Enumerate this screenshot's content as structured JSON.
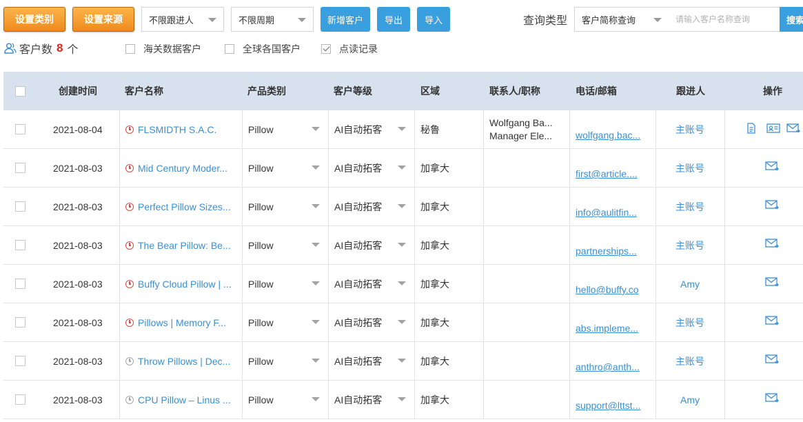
{
  "toolbar": {
    "set_category": "设置类别",
    "set_source": "设置来源",
    "follower_select": "不限跟进人",
    "period_select": "不限周期",
    "add_customer": "新增客户",
    "export": "导出",
    "import": "导入",
    "query_type_label": "查询类型",
    "query_type_select": "客户简称查询",
    "search_placeholder": "请输入客户名称查询",
    "search_button": "搜索"
  },
  "summary": {
    "label": "客户数",
    "count": "8",
    "unit": "个",
    "filters": [
      {
        "label": "海关数据客户",
        "checked": false
      },
      {
        "label": "全球各国客户",
        "checked": false
      },
      {
        "label": "点读记录",
        "checked": true
      }
    ]
  },
  "table": {
    "headers": {
      "created": "创建时间",
      "name": "客户名称",
      "product": "产品类别",
      "level": "客户等级",
      "region": "区域",
      "contact": "联系人/职称",
      "phone_email": "电话/邮箱",
      "follower": "跟进人",
      "action": "操作"
    },
    "rows": [
      {
        "date": "2021-08-04",
        "clock": "red",
        "name": "FLSMIDTH S.A.C.",
        "product": "Pillow",
        "level": "AI自动拓客",
        "region": "秘鲁",
        "contact_name": "Wolfgang Ba...",
        "contact_title": "Manager Ele...",
        "email": "wolfgang.bac...",
        "follower": "主账号"
      },
      {
        "date": "2021-08-03",
        "clock": "red",
        "name": "Mid Century Moder...",
        "product": "Pillow",
        "level": "AI自动拓客",
        "region": "加拿大",
        "contact_name": "",
        "contact_title": "",
        "email": "first@article....",
        "follower": "主账号"
      },
      {
        "date": "2021-08-03",
        "clock": "red",
        "name": "Perfect Pillow Sizes...",
        "product": "Pillow",
        "level": "AI自动拓客",
        "region": "加拿大",
        "contact_name": "",
        "contact_title": "",
        "email": "info@aulitfin...",
        "follower": "主账号"
      },
      {
        "date": "2021-08-03",
        "clock": "red",
        "name": "The Bear Pillow: Be...",
        "product": "Pillow",
        "level": "AI自动拓客",
        "region": "加拿大",
        "contact_name": "",
        "contact_title": "",
        "email": "partnerships...",
        "follower": "主账号"
      },
      {
        "date": "2021-08-03",
        "clock": "red",
        "name": "Buffy Cloud Pillow | ...",
        "product": "Pillow",
        "level": "AI自动拓客",
        "region": "加拿大",
        "contact_name": "",
        "contact_title": "",
        "email": "hello@buffy.co",
        "follower": "Amy"
      },
      {
        "date": "2021-08-03",
        "clock": "red",
        "name": "Pillows | Memory F...",
        "product": "Pillow",
        "level": "AI自动拓客",
        "region": "加拿大",
        "contact_name": "",
        "contact_title": "",
        "email": "abs.impleme...",
        "follower": "主账号"
      },
      {
        "date": "2021-08-03",
        "clock": "gray",
        "name": "Throw Pillows | Dec...",
        "product": "Pillow",
        "level": "AI自动拓客",
        "region": "加拿大",
        "contact_name": "",
        "contact_title": "",
        "email": "anthro@anth...",
        "follower": "主账号"
      },
      {
        "date": "2021-08-03",
        "clock": "gray",
        "name": "CPU Pillow – Linus ...",
        "product": "Pillow",
        "level": "AI自动拓客",
        "region": "加拿大",
        "contact_name": "",
        "contact_title": "",
        "email": "support@lttst...",
        "follower": "Amy"
      }
    ]
  },
  "colors": {
    "accent_blue": "#3a9fde",
    "link_blue": "#3a8fd6",
    "orange": "#f08a1c",
    "count_red": "#e0261f",
    "header_bg": "#d8e2ee"
  }
}
